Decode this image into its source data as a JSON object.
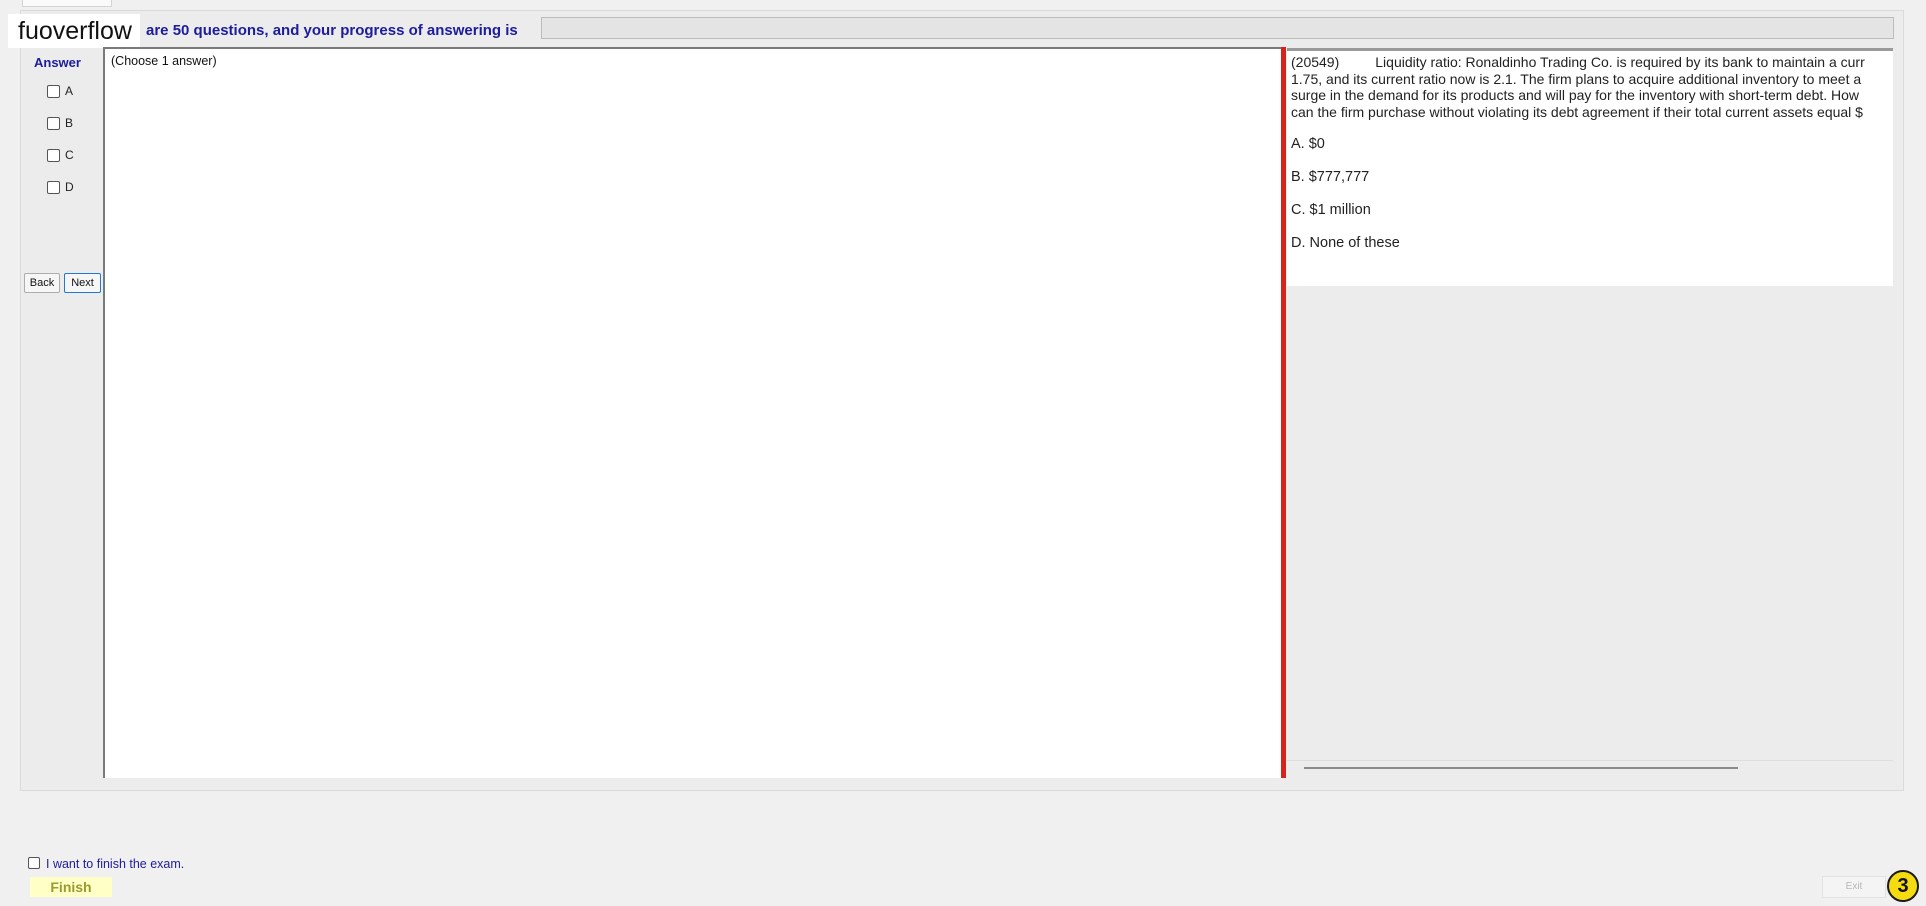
{
  "watermark": "fuoverflow",
  "header": {
    "progress_text": "are 50 questions, and your progress of answering is",
    "progress_fraction": 0
  },
  "sidebar": {
    "answer_title": "Answer",
    "options": [
      "A",
      "B",
      "C",
      "D"
    ],
    "back_label": "Back",
    "next_label": "Next"
  },
  "instruction": "(Choose 1 answer)",
  "question": {
    "id": "(20549)",
    "lines": [
      "Liquidity ratio: Ronaldinho Trading Co. is required by its bank to maintain a curr",
      "1.75, and its current ratio now is 2.1. The firm plans to acquire additional inventory to meet a",
      "surge in the demand for its products and will pay for the inventory with short-term debt. How",
      "can the firm purchase without violating its debt agreement if their total current assets equal $"
    ],
    "choices": [
      "A.  $0",
      "B.  $777,777",
      "C.  $1 million",
      "D.  None of these"
    ]
  },
  "footer": {
    "finish_checkbox_label": "I want to finish the exam.",
    "finish_label": "Finish",
    "exit_label": "Exit",
    "step_badge": "3"
  },
  "colors": {
    "label_blue": "#1c1c9c",
    "splitter_red": "#d4241c",
    "finish_bg": "#ffffc6",
    "badge_yellow": "#f5dc10"
  }
}
